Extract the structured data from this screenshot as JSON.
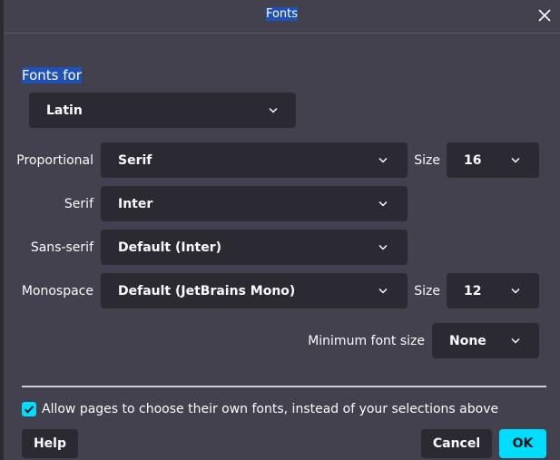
{
  "dialog": {
    "title": "Fonts"
  },
  "fonts_for": {
    "label": "Fonts for",
    "value": "Latin"
  },
  "rows": {
    "proportional": {
      "label": "Proportional",
      "value": "Serif"
    },
    "serif": {
      "label": "Serif",
      "value": "Inter"
    },
    "sans_serif": {
      "label": "Sans-serif",
      "value": "Default (Inter)"
    },
    "monospace": {
      "label": "Monospace",
      "value": "Default (JetBrains Mono)"
    }
  },
  "size": {
    "label": "Size",
    "proportional_value": "16",
    "monospace_value": "12"
  },
  "min_font_size": {
    "label": "Minimum font size",
    "value": "None"
  },
  "allow_pages": {
    "label": "Allow pages to choose their own fonts, instead of your selections above",
    "checked": true
  },
  "buttons": {
    "help": "Help",
    "cancel": "Cancel",
    "ok": "OK"
  },
  "colors": {
    "accent": "#00ddff",
    "background": "#42414d",
    "field": "#2b2a33",
    "highlight": "#1f51b8"
  }
}
